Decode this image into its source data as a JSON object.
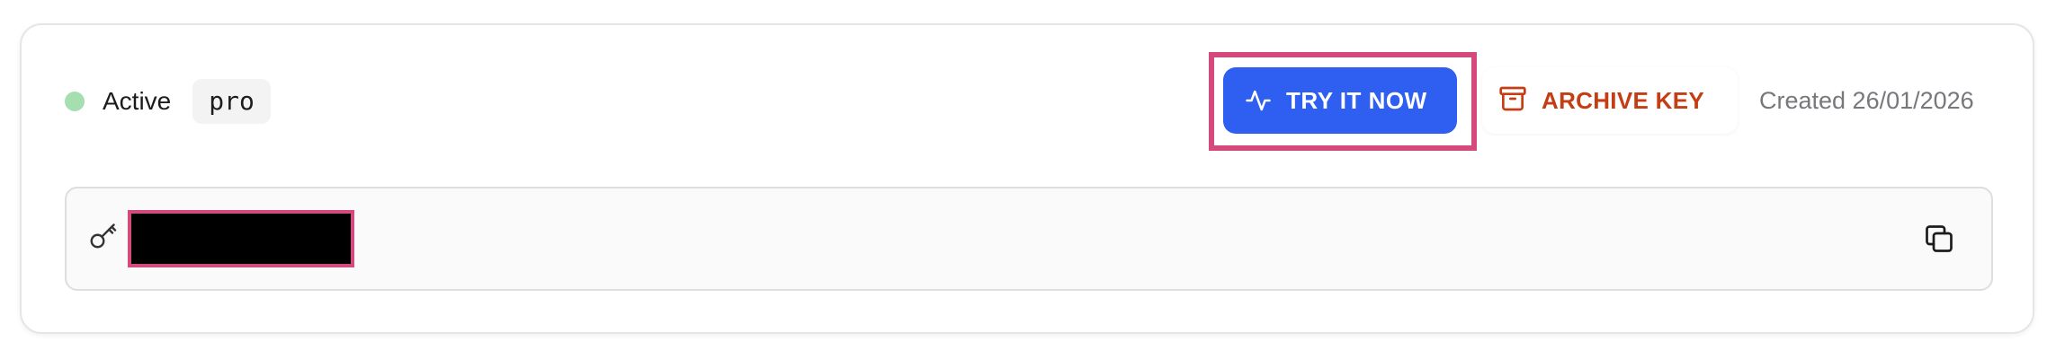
{
  "key_card": {
    "status": {
      "label": "Active",
      "color": "#a5dfb0"
    },
    "tier": "pro",
    "actions": {
      "try_label": "TRY IT NOW",
      "try_color": "#2f5ff0",
      "archive_label": "ARCHIVE KEY",
      "archive_color": "#c43d13"
    },
    "created": "Created 26/01/2026",
    "api_key": {
      "value_redacted": true,
      "icons": [
        "key-icon",
        "copy-icon"
      ]
    },
    "highlight_color": "#d44a7c"
  }
}
